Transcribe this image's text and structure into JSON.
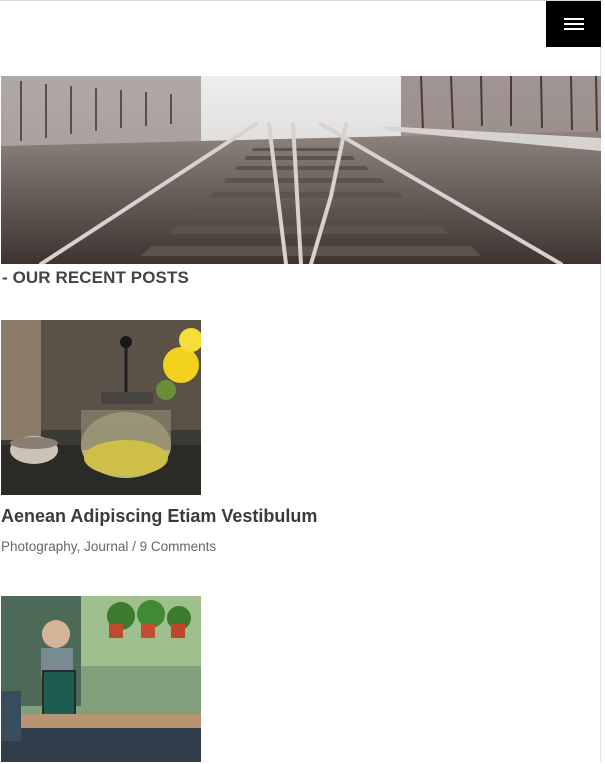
{
  "header": {
    "menu_icon": "hamburger-icon"
  },
  "hero": {
    "image": "railway-tracks-photo"
  },
  "section": {
    "title": "- OUR RECENT POSTS"
  },
  "posts": [
    {
      "image": "tea-pot-photo",
      "title": "Aenean Adipiscing Etiam Vestibulum",
      "category_1": "Photography",
      "category_sep": ",",
      "category_2": "Journal",
      "separator": " / ",
      "comments": "9 Comments"
    },
    {
      "image": "cafe-table-photo"
    }
  ]
}
